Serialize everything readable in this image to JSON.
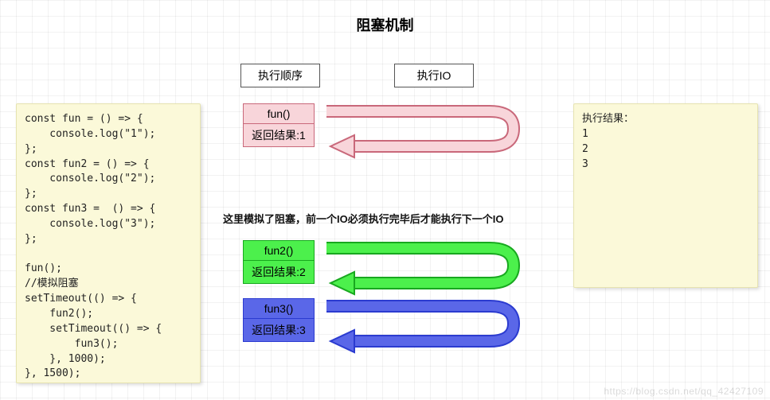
{
  "title": "阻塞机制",
  "labels": {
    "sequence": "执行顺序",
    "io": "执行IO"
  },
  "code_note": "const fun = () => {\n    console.log(\"1\");\n};\nconst fun2 = () => {\n    console.log(\"2\");\n};\nconst fun3 =  () => {\n    console.log(\"3\");\n};\n\nfun();\n//模拟阻塞\nsetTimeout(() => {\n    fun2();\n    setTimeout(() => {\n        fun3();\n    }, 1000);\n}, 1500);",
  "result_note": "执行结果：\n1\n2\n3",
  "blocks": {
    "fn1": {
      "call": "fun()",
      "ret": "返回结果:1"
    },
    "fn2": {
      "call": "fun2()",
      "ret": "返回结果:2"
    },
    "fn3": {
      "call": "fun3()",
      "ret": "返回结果:3"
    }
  },
  "caption": "这里模拟了阻塞，前一个IO必须执行完毕后才能执行下一个IO",
  "colors": {
    "pink": "#f8d5da",
    "green": "#4cf04c",
    "blue": "#5a67e8"
  },
  "watermark": "https://blog.csdn.net/qq_42427109"
}
